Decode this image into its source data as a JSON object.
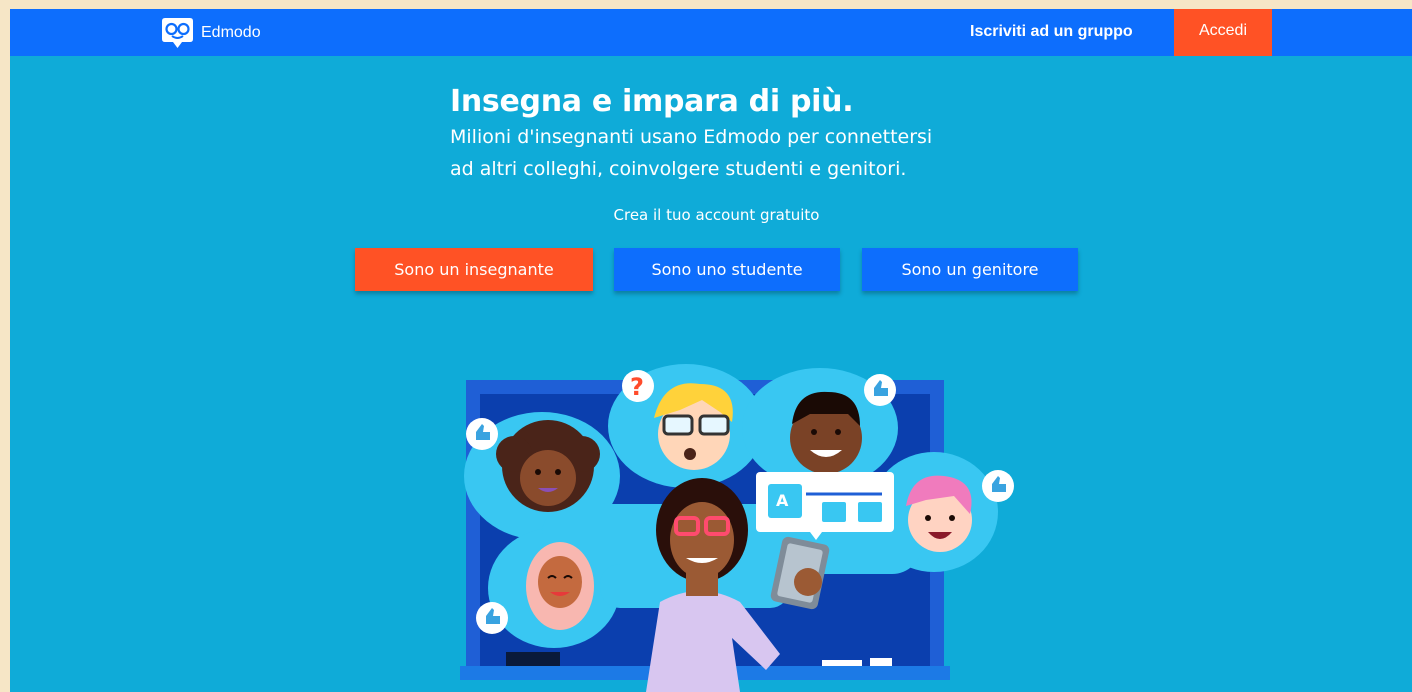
{
  "header": {
    "logo_text": "Edmodo",
    "join_group_label": "Iscriviti ad un gruppo",
    "login_label": "Accedi"
  },
  "hero": {
    "title": "Insegna e impara di più.",
    "subtitle_line1": "Milioni d'insegnanti usano Edmodo per connettersi",
    "subtitle_line2": "ad altri colleghi, coinvolgere studenti e genitori.",
    "cta_text": "Crea il tuo account gratuito"
  },
  "role_buttons": {
    "teacher": "Sono un insegnante",
    "student": "Sono uno studente",
    "parent": "Sono un genitore"
  },
  "illustration": {
    "board_letters": "A",
    "question_mark": "?"
  },
  "colors": {
    "header_bg": "#0d6efd",
    "page_bg": "#0fabd8",
    "accent_orange": "#ff5225",
    "button_blue": "#0d6efd"
  }
}
